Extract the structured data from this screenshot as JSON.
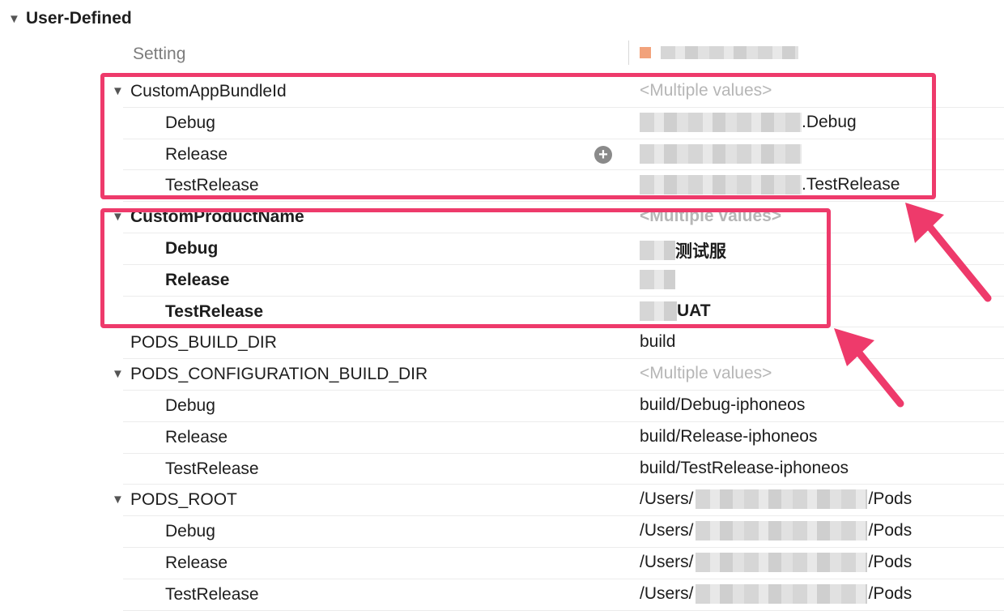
{
  "section": {
    "title": "User-Defined"
  },
  "header": {
    "setting_label": "Setting"
  },
  "rows": [
    {
      "name": "CustomAppBundleId",
      "value": "<Multiple values>",
      "parent": true
    },
    {
      "name": "Debug",
      "value": ".Debug"
    },
    {
      "name": "Release",
      "value": ""
    },
    {
      "name": "TestRelease",
      "value": ".TestRelease"
    },
    {
      "name": "CustomProductName",
      "value": "<Multiple values>",
      "parent": true
    },
    {
      "name": "Debug",
      "value": "测试服"
    },
    {
      "name": "Release",
      "value": ""
    },
    {
      "name": "TestRelease",
      "value": "UAT"
    },
    {
      "name": "PODS_BUILD_DIR",
      "value": "build"
    },
    {
      "name": "PODS_CONFIGURATION_BUILD_DIR",
      "value": "<Multiple values>",
      "parent": true
    },
    {
      "name": "Debug",
      "value": "build/Debug-iphoneos"
    },
    {
      "name": "Release",
      "value": "build/Release-iphoneos"
    },
    {
      "name": "TestRelease",
      "value": "build/TestRelease-iphoneos"
    },
    {
      "name": "PODS_ROOT",
      "value_prefix": "/Users/",
      "value_suffix": "/Pods",
      "parent": true
    },
    {
      "name": "Debug",
      "value_prefix": "/Users/",
      "value_suffix": "/Pods"
    },
    {
      "name": "Release",
      "value_prefix": "/Users/",
      "value_suffix": "/Pods"
    },
    {
      "name": "TestRelease",
      "value_prefix": "/Users/",
      "value_suffix": "/Pods"
    }
  ],
  "colors": {
    "highlight": "#ee3a6b",
    "multi_value": "#b6b6b6"
  }
}
